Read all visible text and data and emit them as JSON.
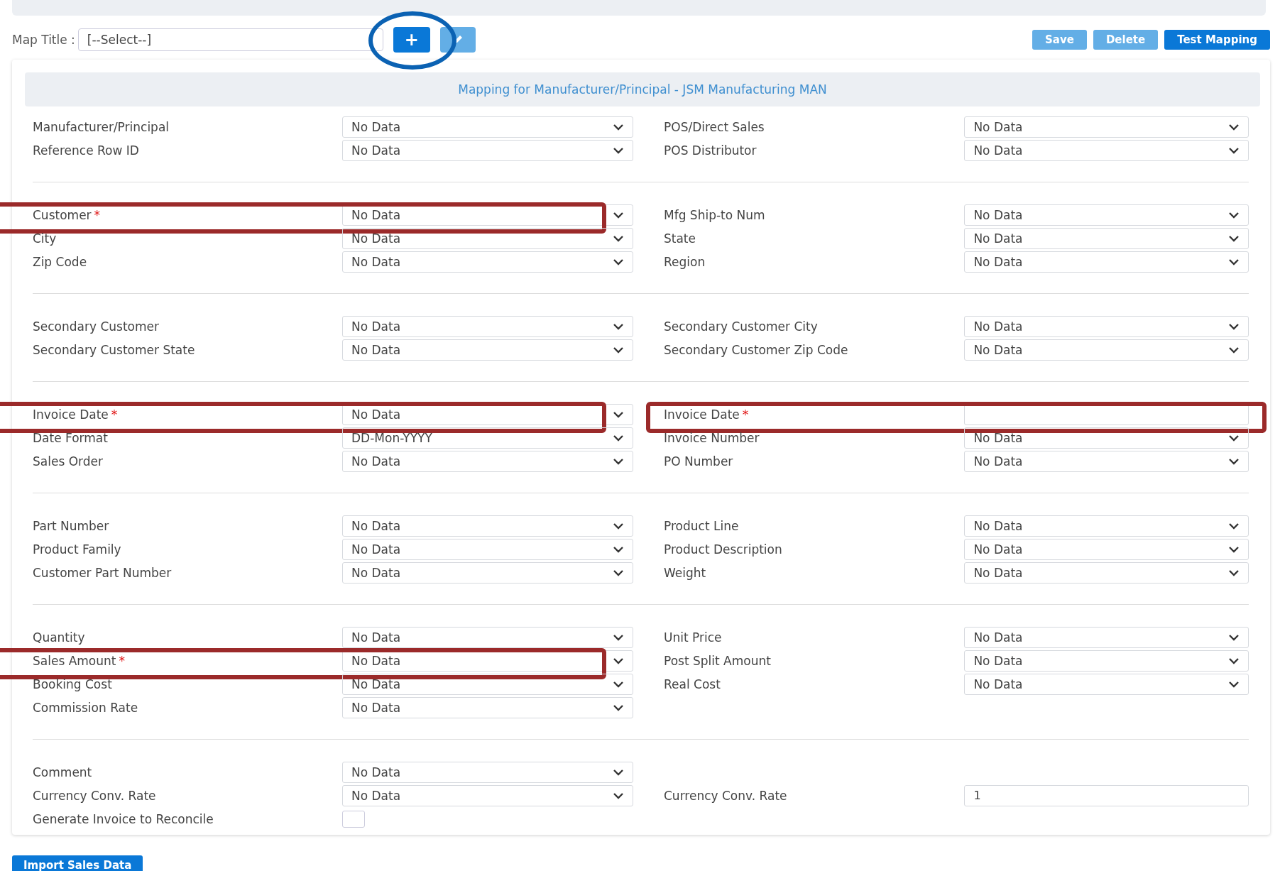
{
  "map_title": {
    "label": "Map Title :",
    "value": "[--Select--]",
    "add_button": {
      "label": "+",
      "circled": true
    }
  },
  "actions": [
    {
      "label": "Save",
      "kind": "light"
    },
    {
      "label": "Delete",
      "kind": "light"
    },
    {
      "label": "Test Mapping",
      "kind": "primary"
    }
  ],
  "panel_title": "Mapping for Manufacturer/Principal - JSM Manufacturing MAN",
  "sections": [
    {
      "rows": [
        {
          "left": {
            "label": "Manufacturer/Principal",
            "kind": "select",
            "value": "No Data",
            "required": false,
            "highlighted": false
          },
          "right": {
            "label": "POS/Direct Sales",
            "kind": "select",
            "value": "No Data",
            "required": false,
            "highlighted": false
          }
        },
        {
          "left": {
            "label": "Reference Row ID",
            "kind": "select",
            "value": "No Data",
            "required": false,
            "highlighted": false
          },
          "right": {
            "label": "POS Distributor",
            "kind": "select",
            "value": "No Data",
            "required": false,
            "highlighted": false
          }
        }
      ]
    },
    {
      "rows": [
        {
          "left": {
            "label": "Customer",
            "kind": "select",
            "value": "No Data",
            "required": true,
            "highlighted": true
          },
          "right": {
            "label": "Mfg Ship-to Num",
            "kind": "select",
            "value": "No Data",
            "required": false,
            "highlighted": false
          }
        },
        {
          "left": {
            "label": "City",
            "kind": "select",
            "value": "No Data",
            "required": false,
            "highlighted": false
          },
          "right": {
            "label": "State",
            "kind": "select",
            "value": "No Data",
            "required": false,
            "highlighted": false
          }
        },
        {
          "left": {
            "label": "Zip Code",
            "kind": "select",
            "value": "No Data",
            "required": false,
            "highlighted": false
          },
          "right": {
            "label": "Region",
            "kind": "select",
            "value": "No Data",
            "required": false,
            "highlighted": false
          }
        }
      ]
    },
    {
      "rows": [
        {
          "left": {
            "label": "Secondary Customer",
            "kind": "select",
            "value": "No Data",
            "required": false,
            "highlighted": false
          },
          "right": {
            "label": "Secondary Customer City",
            "kind": "select",
            "value": "No Data",
            "required": false,
            "highlighted": false
          }
        },
        {
          "left": {
            "label": "Secondary Customer State",
            "kind": "select",
            "value": "No Data",
            "required": false,
            "highlighted": false
          },
          "right": {
            "label": "Secondary Customer Zip Code",
            "kind": "select",
            "value": "No Data",
            "required": false,
            "highlighted": false
          }
        }
      ]
    },
    {
      "rows": [
        {
          "left": {
            "label": "Invoice Date",
            "kind": "select",
            "value": "No Data",
            "required": true,
            "highlighted": true
          },
          "right": {
            "label": "Invoice Date",
            "kind": "text",
            "required": true,
            "highlighted": true
          }
        },
        {
          "left": {
            "label": "Date Format",
            "kind": "select",
            "value": "DD-Mon-YYYY",
            "required": false,
            "highlighted": false
          },
          "right": {
            "label": "Invoice Number",
            "kind": "select",
            "value": "No Data",
            "required": false,
            "highlighted": false
          }
        },
        {
          "left": {
            "label": "Sales Order",
            "kind": "select",
            "value": "No Data",
            "required": false,
            "highlighted": false
          },
          "right": {
            "label": "PO Number",
            "kind": "select",
            "value": "No Data",
            "required": false,
            "highlighted": false
          }
        }
      ]
    },
    {
      "rows": [
        {
          "left": {
            "label": "Part Number",
            "kind": "select",
            "value": "No Data",
            "required": false,
            "highlighted": false
          },
          "right": {
            "label": "Product Line",
            "kind": "select",
            "value": "No Data",
            "required": false,
            "highlighted": false
          }
        },
        {
          "left": {
            "label": "Product Family",
            "kind": "select",
            "value": "No Data",
            "required": false,
            "highlighted": false
          },
          "right": {
            "label": "Product Description",
            "kind": "select",
            "value": "No Data",
            "required": false,
            "highlighted": false
          }
        },
        {
          "left": {
            "label": "Customer Part Number",
            "kind": "select",
            "value": "No Data",
            "required": false,
            "highlighted": false
          },
          "right": {
            "label": "Weight",
            "kind": "select",
            "value": "No Data",
            "required": false,
            "highlighted": false
          }
        }
      ]
    },
    {
      "rows": [
        {
          "left": {
            "label": "Quantity",
            "kind": "select",
            "value": "No Data",
            "required": false,
            "highlighted": false
          },
          "right": {
            "label": "Unit Price",
            "kind": "select",
            "value": "No Data",
            "required": false,
            "highlighted": false
          }
        },
        {
          "left": {
            "label": "Sales Amount",
            "kind": "select",
            "value": "No Data",
            "required": true,
            "highlighted": true
          },
          "right": {
            "label": "Post Split Amount",
            "kind": "select",
            "value": "No Data",
            "required": false,
            "highlighted": false
          }
        },
        {
          "left": {
            "label": "Booking Cost",
            "kind": "select",
            "value": "No Data",
            "required": false,
            "highlighted": false
          },
          "right": {
            "label": "Real Cost",
            "kind": "select",
            "value": "No Data",
            "required": false,
            "highlighted": false
          }
        },
        {
          "left": {
            "label": "Commission Rate",
            "kind": "select",
            "value": "No Data",
            "required": false,
            "highlighted": false
          }
        }
      ]
    },
    {
      "rows": [
        {
          "left": {
            "label": "Comment",
            "kind": "select",
            "value": "No Data",
            "required": false,
            "highlighted": false
          }
        },
        {
          "left": {
            "label": "Currency Conv. Rate",
            "kind": "select",
            "value": "No Data",
            "required": false,
            "highlighted": false
          },
          "right": {
            "label": "Currency Conv. Rate",
            "kind": "text",
            "value": "1",
            "required": false,
            "highlighted": false
          }
        },
        {
          "left": {
            "label": "Generate Invoice to Reconcile",
            "kind": "checkbox",
            "checked": false,
            "required": false,
            "highlighted": false
          }
        }
      ]
    }
  ],
  "required_mark": "*",
  "import_button": "Import Sales Data"
}
